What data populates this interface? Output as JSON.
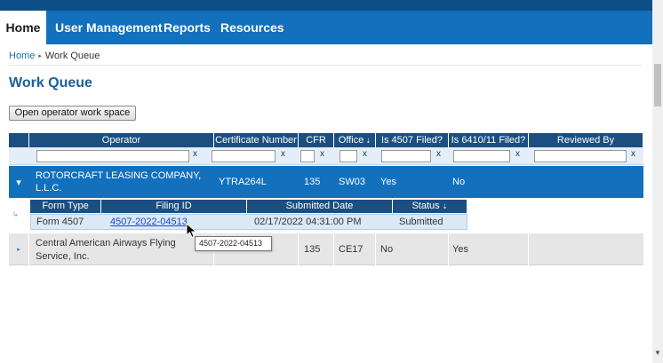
{
  "nav": {
    "items": [
      {
        "label": "Home",
        "active": true
      },
      {
        "label": "User Management",
        "active": false
      },
      {
        "label": "Reports",
        "active": false
      },
      {
        "label": "Resources",
        "active": false
      }
    ]
  },
  "breadcrumb": {
    "home": "Home",
    "current": "Work Queue"
  },
  "page": {
    "title": "Work Queue"
  },
  "toolbar": {
    "open_workspace_label": "Open operator work space"
  },
  "grid": {
    "columns": [
      "Operator",
      "Certificate Number",
      "CFR",
      "Office",
      "Is 4507 Filed?",
      "Is 6410/11 Filed?",
      "Reviewed By"
    ],
    "filter_clear": "x",
    "rows": [
      {
        "operator_line1": "ROTORCRAFT LEASING COMPANY,",
        "operator_line2": "L.L.C.",
        "certificate": "YTRA264L",
        "cfr": "135",
        "office": "SW03",
        "is4507": "Yes",
        "is6410": "No",
        "reviewed_by": ""
      },
      {
        "operator_line1": "Central American Airways Flying",
        "operator_line2": "Service, Inc.",
        "certificate": "",
        "cfr": "135",
        "office": "CE17",
        "is4507": "No",
        "is6410": "Yes",
        "reviewed_by": ""
      }
    ],
    "subgrid": {
      "columns": [
        "Form Type",
        "Filing ID",
        "Submitted Date",
        "Status"
      ],
      "rows": [
        {
          "form_type": "Form 4507",
          "filing_id": "4507-2022-04513",
          "submitted": "02/17/2022 04:31:00 PM",
          "status": "Submitted"
        }
      ]
    }
  },
  "tooltip": {
    "text": "4507-2022-04513"
  },
  "colors": {
    "nav_bg": "#1270bd",
    "header_bg": "#1c4f80",
    "selected_row": "#1270bd",
    "title": "#1b5f9a"
  }
}
